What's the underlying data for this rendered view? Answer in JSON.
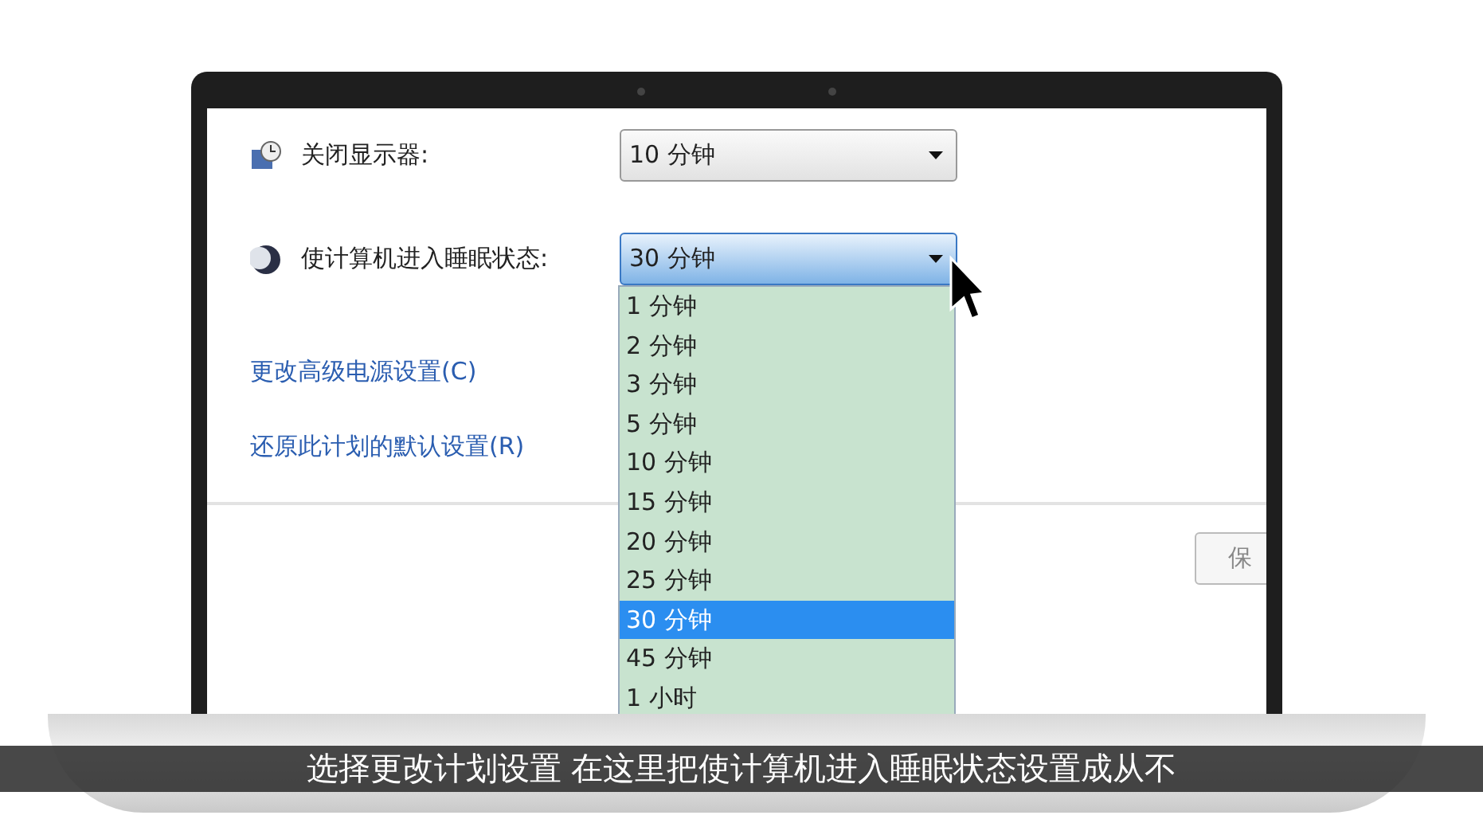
{
  "settings": [
    {
      "kind": "display",
      "label": "关闭显示器:",
      "value": "10 分钟",
      "open": false
    },
    {
      "kind": "sleep",
      "label": "使计算机进入睡眠状态:",
      "value": "30 分钟",
      "open": true,
      "options": [
        {
          "label": "1 分钟",
          "selected": false
        },
        {
          "label": "2 分钟",
          "selected": false
        },
        {
          "label": "3 分钟",
          "selected": false
        },
        {
          "label": "5 分钟",
          "selected": false
        },
        {
          "label": "10 分钟",
          "selected": false
        },
        {
          "label": "15 分钟",
          "selected": false
        },
        {
          "label": "20 分钟",
          "selected": false
        },
        {
          "label": "25 分钟",
          "selected": false
        },
        {
          "label": "30 分钟",
          "selected": true
        },
        {
          "label": "45 分钟",
          "selected": false
        },
        {
          "label": "1 小时",
          "selected": false
        }
      ]
    }
  ],
  "links": [
    "更改高级电源设置(C)",
    "还原此计划的默认设置(R)"
  ],
  "buttons": [
    "保"
  ],
  "caption": "选择更改计划设置 在这里把使计算机进入睡眠状态设置成从不"
}
